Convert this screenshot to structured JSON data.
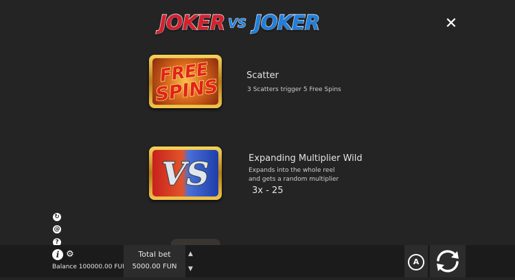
{
  "logo": {
    "left_word": "JOKER",
    "vs": "VS",
    "right_word": "JOKER"
  },
  "close": {
    "icon": "close-icon",
    "glyph": "✕"
  },
  "symbols": [
    {
      "name": "free-spins-symbol",
      "art_text": [
        "FREE",
        "SPINS"
      ],
      "title": "Scatter",
      "description": [
        "3 Scatters trigger 5 Free Spins"
      ]
    },
    {
      "name": "vs-wild-symbol",
      "art_text": [
        "VS"
      ],
      "title": "Expanding Multiplier Wild",
      "description": [
        "Expands into the whole reel",
        "and gets a random multiplier"
      ],
      "multiplier": "3x - 25"
    }
  ],
  "side_icons": [
    {
      "name": "history-icon",
      "glyph": "↻"
    },
    {
      "name": "sound-icon",
      "glyph": "@"
    },
    {
      "name": "help-icon",
      "glyph": "?"
    }
  ],
  "bottom": {
    "info_glyph": "i",
    "settings_glyph": "⚙",
    "balance_label": "Balance",
    "balance_value": "100000.00",
    "currency": "FUN",
    "total_bet_label": "Total bet",
    "total_bet_value": "5000.00",
    "bet_up_glyph": "▲",
    "bet_down_glyph": "▼",
    "autoplay_label": "A"
  }
}
